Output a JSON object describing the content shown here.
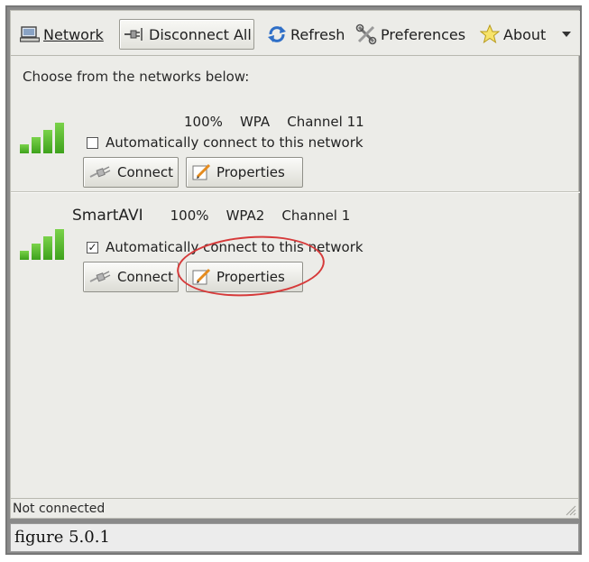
{
  "toolbar": {
    "network_label": "Network",
    "disconnect_all_label": "Disconnect All",
    "refresh_label": "Refresh",
    "preferences_label": "Preferences",
    "about_label": "About"
  },
  "prompt": "Choose from the networks below:",
  "networks": [
    {
      "ssid": "",
      "signal": "100%",
      "security": "WPA",
      "channel": "Channel 11",
      "auto_connect_label": "Automatically connect to this network",
      "auto_connect": false,
      "connect_label": "Connect",
      "properties_label": "Properties"
    },
    {
      "ssid": "SmartAVI",
      "signal": "100%",
      "security": "WPA2",
      "channel": "Channel 1",
      "auto_connect_label": "Automatically connect to this network",
      "auto_connect": true,
      "connect_label": "Connect",
      "properties_label": "Properties"
    }
  ],
  "status_text": "Not connected",
  "caption": "figure 5.0.1",
  "colors": {
    "signal_bar": "#4caf2a",
    "highlight_ring": "#d63a3a",
    "window_bg": "#ecece8"
  },
  "icons": [
    "network-icon",
    "disconnect-plug-icon",
    "refresh-icon",
    "preferences-tools-icon",
    "about-star-icon",
    "dropdown-arrow-icon",
    "signal-bars-icon",
    "plug-icon",
    "pencil-note-icon",
    "resize-grip-icon"
  ]
}
